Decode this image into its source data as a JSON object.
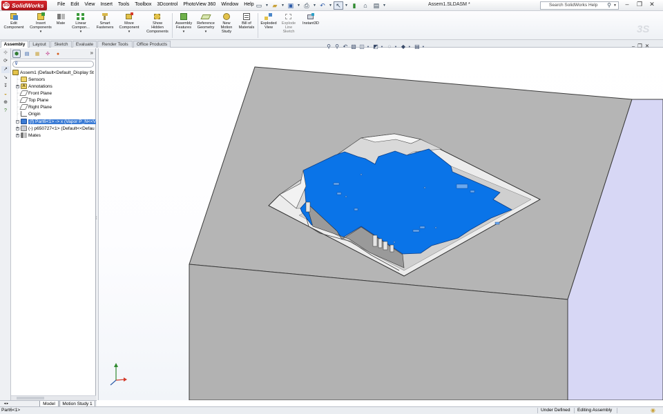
{
  "app": {
    "logo_text": "SolidWorks",
    "document_title": "Assem1.SLDASM *"
  },
  "menu": [
    "File",
    "Edit",
    "View",
    "Insert",
    "Tools",
    "Toolbox",
    "3Dcontrol",
    "PhotoView 360",
    "Window",
    "Help"
  ],
  "quick_access": [
    "new-document-icon",
    "open-folder-icon",
    "save-icon",
    "print-icon",
    "undo-icon",
    "select-icon",
    "rebuild-icon",
    "file-properties-icon",
    "options-icon"
  ],
  "search": {
    "placeholder": "Search SolidWorks Help"
  },
  "window_controls": [
    "minimize",
    "restore",
    "close"
  ],
  "command_manager": [
    {
      "label": "Edit\nComponent",
      "icon": "edit-component-icon",
      "enabled": true,
      "dropdown": false
    },
    {
      "label": "Insert\nComponents",
      "icon": "insert-components-icon",
      "enabled": true,
      "dropdown": true
    },
    {
      "label": "Mate",
      "icon": "mate-icon",
      "enabled": true,
      "dropdown": false
    },
    {
      "label": "Linear\nCompon...",
      "icon": "linear-pattern-icon",
      "enabled": true,
      "dropdown": true
    },
    {
      "label": "Smart\nFasteners",
      "icon": "smart-fasteners-icon",
      "enabled": true,
      "dropdown": false
    },
    {
      "label": "Move\nComponent",
      "icon": "move-component-icon",
      "enabled": true,
      "dropdown": true
    },
    {
      "label": "Show\nHidden\nComponents",
      "icon": "show-hidden-icon",
      "enabled": true,
      "dropdown": false
    },
    {
      "label": "Assembly\nFeatures",
      "icon": "assembly-features-icon",
      "enabled": true,
      "dropdown": true
    },
    {
      "label": "Reference\nGeometry",
      "icon": "reference-geometry-icon",
      "enabled": true,
      "dropdown": true
    },
    {
      "label": "New\nMotion\nStudy",
      "icon": "motion-study-icon",
      "enabled": true,
      "dropdown": false
    },
    {
      "label": "Bill of\nMaterials",
      "icon": "bill-of-materials-icon",
      "enabled": true,
      "dropdown": false
    },
    {
      "label": "Exploded\nView",
      "icon": "exploded-view-icon",
      "enabled": true,
      "dropdown": false
    },
    {
      "label": "Explode\nLine\nSketch",
      "icon": "explode-line-sketch-icon",
      "enabled": false,
      "dropdown": false
    },
    {
      "label": "Instant3D",
      "icon": "instant3d-icon",
      "enabled": true,
      "dropdown": false
    }
  ],
  "tabs": [
    {
      "label": "Assembly",
      "active": true
    },
    {
      "label": "Layout",
      "active": false
    },
    {
      "label": "Sketch",
      "active": false
    },
    {
      "label": "Evaluate",
      "active": false
    },
    {
      "label": "Render Tools",
      "active": false
    },
    {
      "label": "Office Products",
      "active": false
    }
  ],
  "manager_tabs": [
    "featuremanager-icon",
    "propertymanager-icon",
    "configurationmanager-icon",
    "dimxpert-icon",
    "display-manager-icon"
  ],
  "feature_tree": [
    {
      "label": "Assem1  (Default<Default_Display St",
      "icon": "assembly-icon",
      "selected": false
    },
    {
      "label": "Sensors",
      "icon": "sensors-icon",
      "selected": false
    },
    {
      "label": "Annotations",
      "icon": "annotations-icon",
      "selected": false
    },
    {
      "label": "Front Plane",
      "icon": "plane-icon",
      "selected": false
    },
    {
      "label": "Top Plane",
      "icon": "plane-icon",
      "selected": false
    },
    {
      "label": "Right Plane",
      "icon": "plane-icon",
      "selected": false
    },
    {
      "label": "Origin",
      "icon": "origin-icon",
      "selected": false
    },
    {
      "label": "(f) Part6<1> -> x (Vapor P_N<<V",
      "icon": "part-icon",
      "selected": true
    },
    {
      "label": "(-) p650727<1> (Default<<Defau",
      "icon": "part-icon",
      "selected": false
    },
    {
      "label": "Mates",
      "icon": "mates-icon",
      "selected": false
    }
  ],
  "bottom_tabs": [
    {
      "label": "Model",
      "active": true
    },
    {
      "label": "Motion Study 1",
      "active": false
    }
  ],
  "status_bar": {
    "selection": "Part6<1>",
    "sketch_state": "Under Defined",
    "mode": "Editing Assembly"
  },
  "colors": {
    "part_face": "#b4b4b4",
    "side_face": "#d6d6f4",
    "selected_blue": "#0a74e8",
    "title_red": "#b51b20"
  }
}
